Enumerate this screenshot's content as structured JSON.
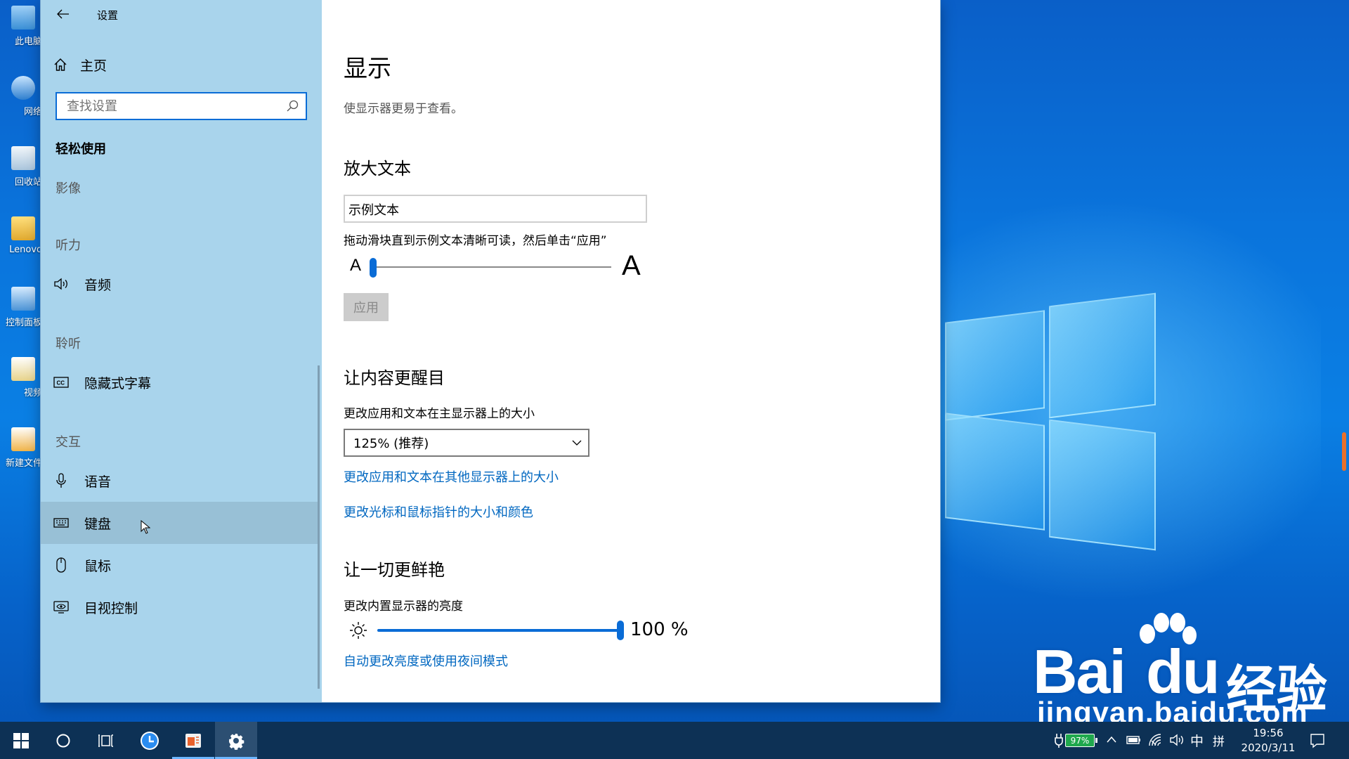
{
  "window": {
    "title": "设置"
  },
  "sidebar": {
    "home_label": "主页",
    "search_placeholder": "查找设置",
    "section_title": "轻松使用",
    "groups": [
      {
        "title": "影像"
      },
      {
        "title": "听力"
      },
      {
        "title": "聆听"
      },
      {
        "title": "交互"
      }
    ],
    "items": [
      {
        "label": "音频",
        "icon": "speaker-icon"
      },
      {
        "label": "隐藏式字幕",
        "icon": "closed-caption-icon"
      },
      {
        "label": "语音",
        "icon": "microphone-icon"
      },
      {
        "label": "键盘",
        "icon": "keyboard-icon",
        "hovered": true
      },
      {
        "label": "鼠标",
        "icon": "mouse-icon"
      },
      {
        "label": "目视控制",
        "icon": "eye-control-icon"
      }
    ]
  },
  "content": {
    "title": "显示",
    "description": "使显示器更易于查看。",
    "enlarge_text": {
      "title": "放大文本",
      "sample_text": "示例文本",
      "instruction": "拖动滑块直到示例文本清晰可读，然后单击“应用”",
      "small_a": "A",
      "large_a": "A",
      "slider_value_fraction": 0.0,
      "apply_label": "应用"
    },
    "bigger": {
      "title": "让内容更醒目",
      "scale_label": "更改应用和文本在主显示器上的大小",
      "scale_value": "125% (推荐)",
      "link_other_displays": "更改应用和文本在其他显示器上的大小",
      "link_cursor": "更改光标和鼠标指针的大小和颜色"
    },
    "brighter": {
      "title": "让一切更鲜艳",
      "brightness_label": "更改内置显示器的亮度",
      "brightness_value": "100 %",
      "brightness_fraction": 1.0,
      "link_night_mode": "自动更改亮度或使用夜间模式"
    }
  },
  "desktop": {
    "icons": [
      {
        "label": "此电脑"
      },
      {
        "label": "网络"
      },
      {
        "label": "回收站"
      },
      {
        "label": "Lenovo"
      },
      {
        "label": "控制面板"
      },
      {
        "label": "视频"
      },
      {
        "label": "新建文件"
      }
    ],
    "watermark": {
      "brand": "Bai",
      "brand_du": "du",
      "brand_cn": "经验",
      "url": "jingyan.baidu.com"
    }
  },
  "taskbar": {
    "battery_percent": "97%",
    "ime_label": "中",
    "ime_mode": "拼",
    "time": "19:56",
    "date": "2020/3/11"
  },
  "colors": {
    "accent": "#0a6cd6",
    "sidebar_bg": "#a9d4ec",
    "link": "#0067c0",
    "taskbar_bg": "#0d3155"
  }
}
